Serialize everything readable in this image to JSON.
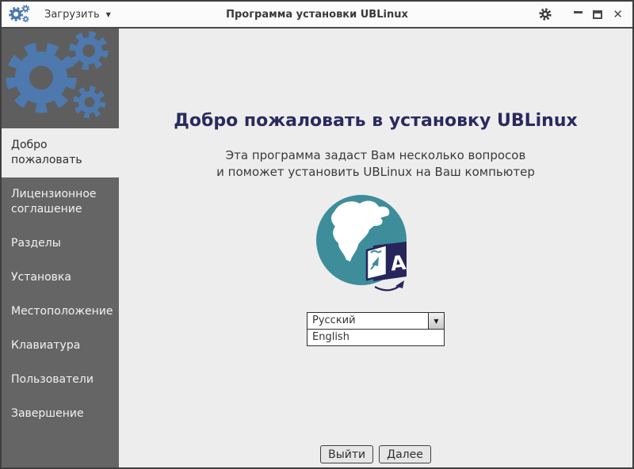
{
  "titlebar": {
    "title": "Программа установки UBLinux",
    "load_button": "Загрузить"
  },
  "icons": {
    "menu_arrow": "▼",
    "combo_arrow": "▼",
    "close": "✕",
    "translate_letter": "A"
  },
  "sidebar": {
    "items": [
      {
        "label": "Добро пожаловать",
        "selected": true
      },
      {
        "label": "Лицензионное соглашение",
        "selected": false
      },
      {
        "label": "Разделы",
        "selected": false
      },
      {
        "label": "Установка",
        "selected": false
      },
      {
        "label": "Местоположение",
        "selected": false
      },
      {
        "label": "Клавиатура",
        "selected": false
      },
      {
        "label": "Пользователи",
        "selected": false
      },
      {
        "label": "Завершение",
        "selected": false
      }
    ]
  },
  "main": {
    "heading": "Добро пожаловать в установку UBLinux",
    "subtitle_line1": "Эта программа задаст Вам несколько вопросов",
    "subtitle_line2": "и поможет установить UBLinux на Ваш компьютер",
    "language": {
      "selected": "Русский",
      "options": [
        "English"
      ]
    },
    "footer": {
      "quit": "Выйти",
      "next": "Далее"
    }
  },
  "colors": {
    "accent_blue": "#4d79ae",
    "sidebar_gray": "#666566",
    "logo_block_gray": "#5e5e5e",
    "heading_navy": "#2b2a5e",
    "globe_teal": "#3d8e9a",
    "badge_navy": "#27265c",
    "window_border": "#3f3f3f"
  }
}
